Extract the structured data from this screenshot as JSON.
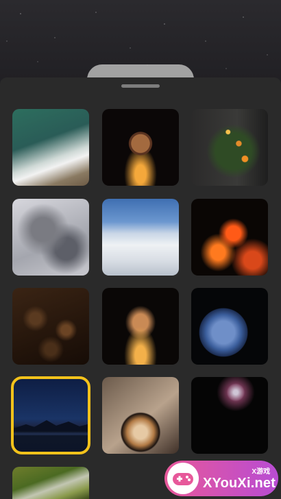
{
  "sheet": {
    "tiles": [
      {
        "name": "ocean-waves",
        "selected": false
      },
      {
        "name": "christmas-ornament-candles",
        "selected": false
      },
      {
        "name": "christmas-tree-lights",
        "selected": false
      },
      {
        "name": "blurred-clouds",
        "selected": false
      },
      {
        "name": "sky-above-clouds",
        "selected": false
      },
      {
        "name": "fireplace",
        "selected": false
      },
      {
        "name": "rain-window-bokeh",
        "selected": false
      },
      {
        "name": "candle-tree",
        "selected": false
      },
      {
        "name": "earth-globe",
        "selected": false
      },
      {
        "name": "night-mountain-lake",
        "selected": true
      },
      {
        "name": "latte-art",
        "selected": false
      },
      {
        "name": "fireworks",
        "selected": false
      },
      {
        "name": "moss-forest",
        "selected": false
      }
    ]
  },
  "watermark": {
    "brand": "XYouXi.net",
    "tag": "X游戏"
  },
  "colors": {
    "selected_outline": "#f3c21b",
    "sheet_bg": "#2a2a2a",
    "grabber": "#7d7d7d"
  }
}
